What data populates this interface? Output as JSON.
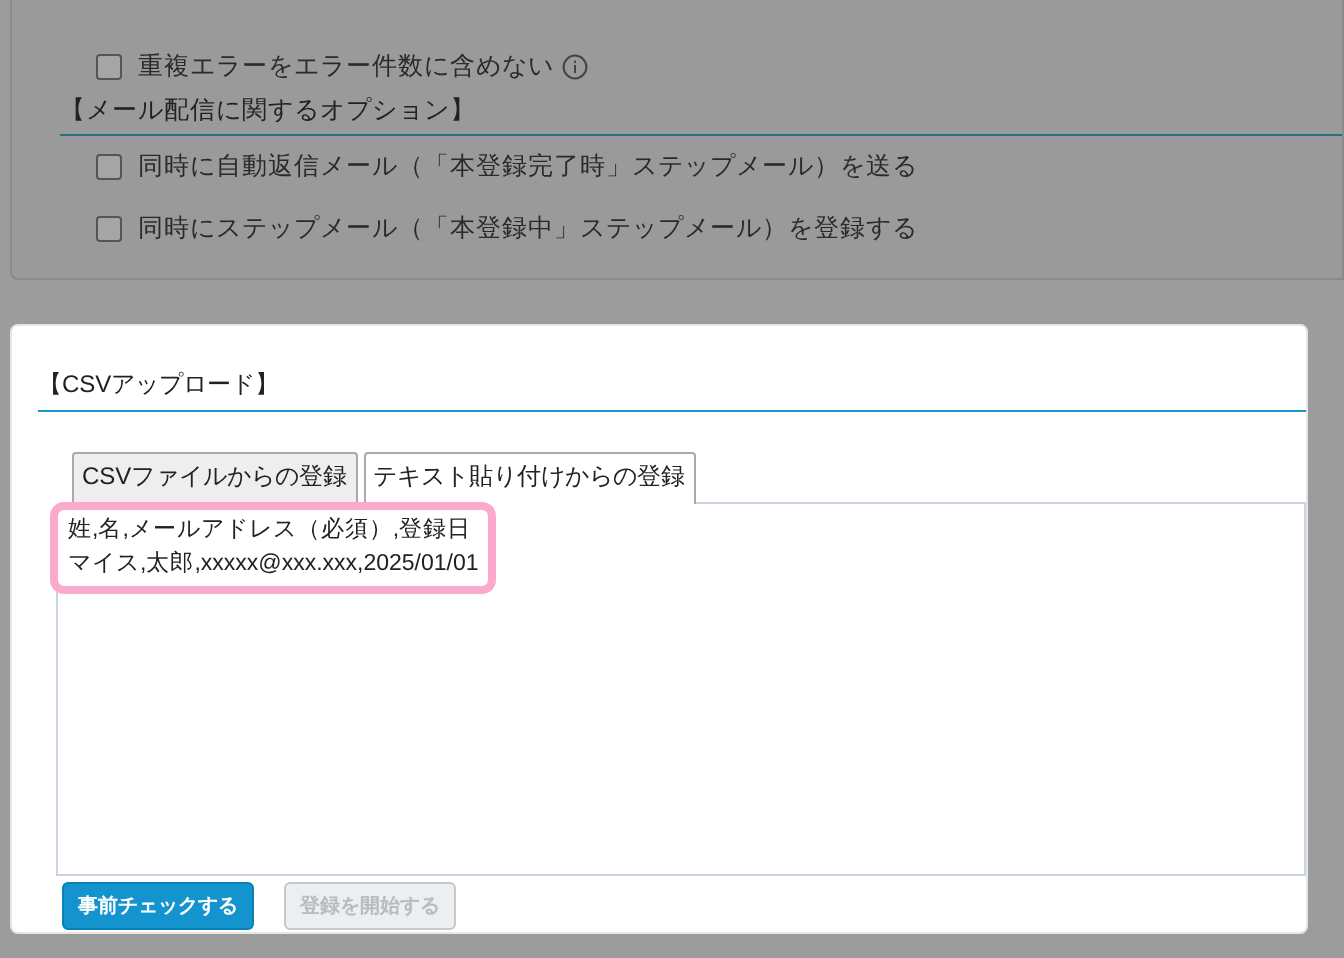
{
  "background_panel": {
    "options": [
      {
        "label": "重複エラーをエラー件数に含めない",
        "checked": false,
        "info": true
      }
    ],
    "mail_section_title": "【メール配信に関するオプション】",
    "mail_options": [
      {
        "label": "同時に自動返信メール（「本登録完了時」ステップメール）を送る",
        "checked": false
      },
      {
        "label": "同時にステップメール（「本登録中」ステップメール）を登録する",
        "checked": false
      }
    ]
  },
  "modal": {
    "title": "【CSVアップロード】",
    "tabs": [
      {
        "label": "CSVファイルからの登録",
        "selected": false
      },
      {
        "label": "テキスト貼り付けからの登録",
        "selected": true
      }
    ],
    "text_lines": [
      "姓,名,メールアドレス（必須）,登録日",
      "マイス,太郎,xxxxx@xxx.xxx,2025/01/01"
    ],
    "highlighted": true,
    "buttons": [
      {
        "label": "事前チェックする",
        "disabled": false
      },
      {
        "label": "登録を開始する",
        "disabled": true
      }
    ]
  }
}
